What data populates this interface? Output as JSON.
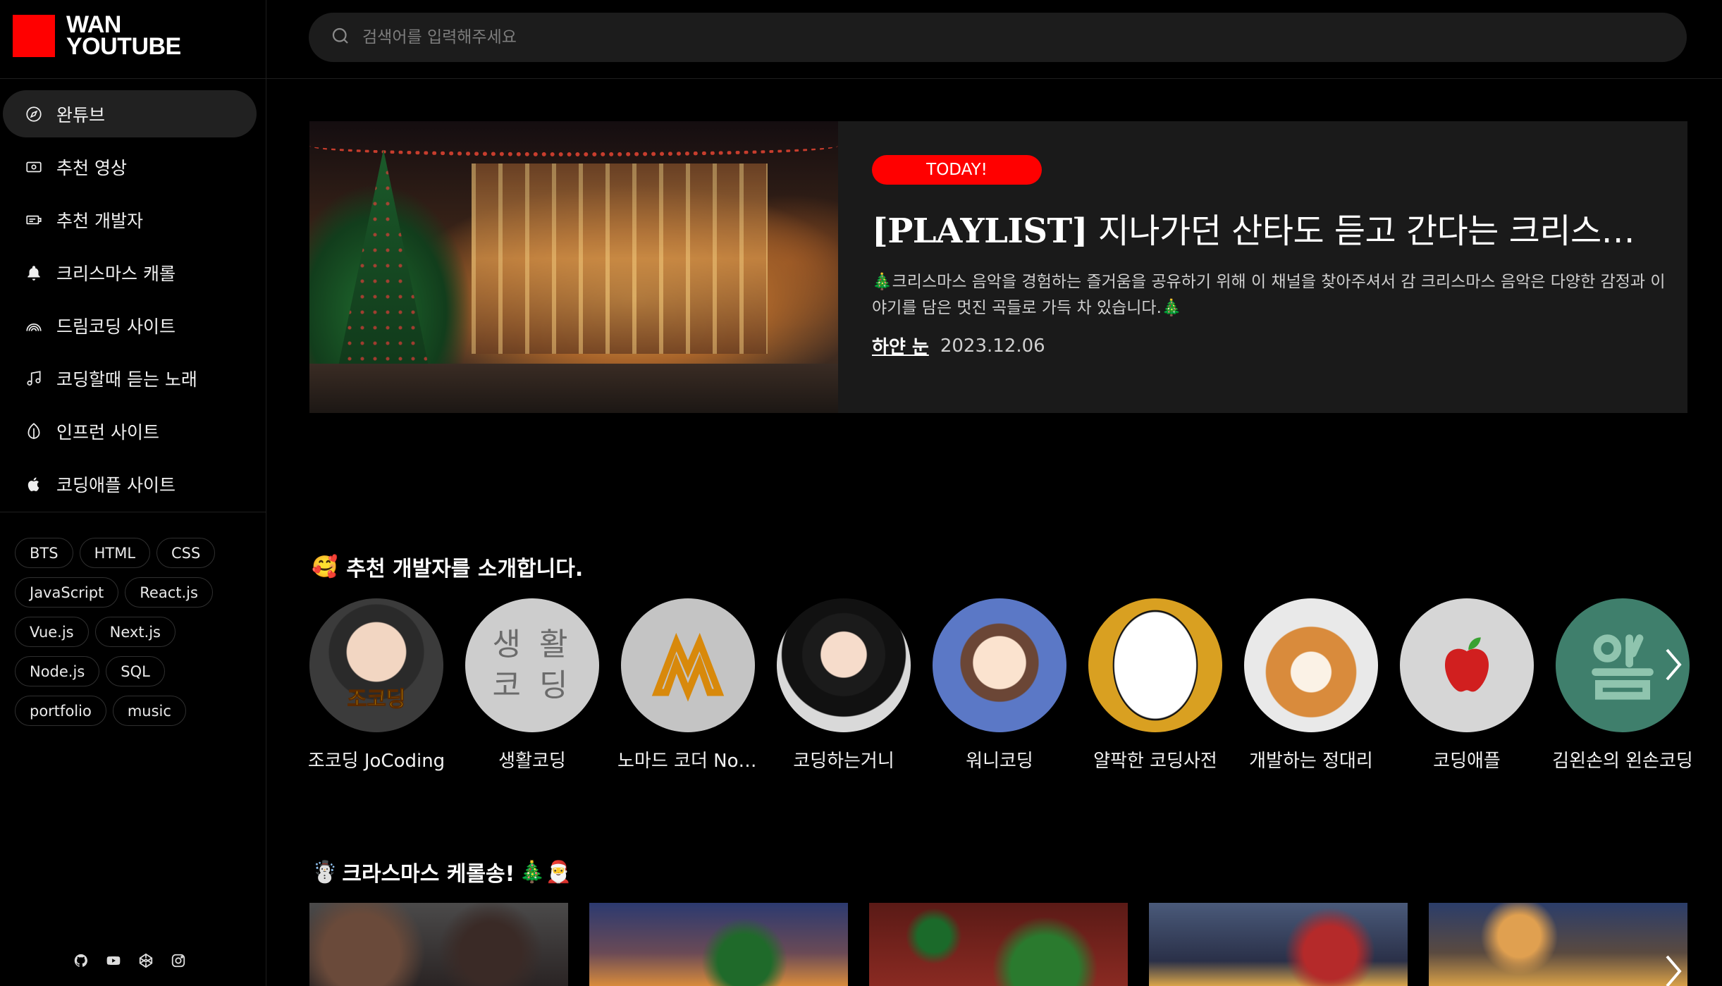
{
  "logo": {
    "line1": "WAN",
    "line2": "YOUTUBE",
    "color": "#ff0000"
  },
  "sidebar": {
    "menu": [
      {
        "label": "완튜브",
        "icon": "compass-icon",
        "active": true
      },
      {
        "label": "추천 영상",
        "icon": "video-icon",
        "active": false
      },
      {
        "label": "추천 개발자",
        "icon": "developer-icon",
        "active": false
      },
      {
        "label": "크리스마스 캐롤",
        "icon": "bell-icon",
        "active": false
      },
      {
        "label": "드림코딩 사이트",
        "icon": "rainbow-icon",
        "active": false
      },
      {
        "label": "코딩할때 듣는 노래",
        "icon": "music-note-icon",
        "active": false
      },
      {
        "label": "인프런 사이트",
        "icon": "leaf-icon",
        "active": false
      },
      {
        "label": "코딩애플 사이트",
        "icon": "apple-icon",
        "active": false
      }
    ],
    "tags": [
      "BTS",
      "HTML",
      "CSS",
      "JavaScript",
      "React.js",
      "Vue.js",
      "Next.js",
      "Node.js",
      "SQL",
      "portfolio",
      "music"
    ],
    "social": [
      "github-icon",
      "youtube-icon",
      "codepen-icon",
      "instagram-icon"
    ]
  },
  "search": {
    "placeholder": "검색어를 입력해주세요",
    "value": ""
  },
  "featured": {
    "badge": "TODAY!",
    "title_prefix": "[PLAYLIST]",
    "title_rest": " 지나가던 산타도 듣고 간다는 크리스마스 캐롤",
    "description": "🎄크리스마스 음악을 경험하는 즐거움을 공유하기 위해 이 채널을 찾아주셔서 감 크리스마스 음악은 다양한 감정과 이야기를 담은 멋진 곡들로 가득 차 있습니다.🎄",
    "author": "하얀 눈",
    "date": "2023.12.06"
  },
  "developers": {
    "emoji": "🥰",
    "title": "추천 개발자를 소개합니다.",
    "items": [
      {
        "name": "조코딩 JoCoding"
      },
      {
        "name": "생활코딩"
      },
      {
        "name": "노마드 코더 Nomad Coders"
      },
      {
        "name": "코딩하는거니"
      },
      {
        "name": "워니코딩"
      },
      {
        "name": "얄팍한 코딩사전"
      },
      {
        "name": "개발하는 정대리"
      },
      {
        "name": "코딩애플"
      },
      {
        "name": "김왼손의 왼손코딩"
      }
    ],
    "avatar_texts": {
      "saenghwal": "생 활\n코 딩",
      "jocoding_badge": "조코딩"
    }
  },
  "carols": {
    "emoji_left": "☃️",
    "title": "크라스마스 케롤송!",
    "emoji_right": "🎄🎅",
    "count": 5
  },
  "colors": {
    "accent": "#ff0000",
    "panel": "#1a1a1a",
    "background": "#000000"
  }
}
